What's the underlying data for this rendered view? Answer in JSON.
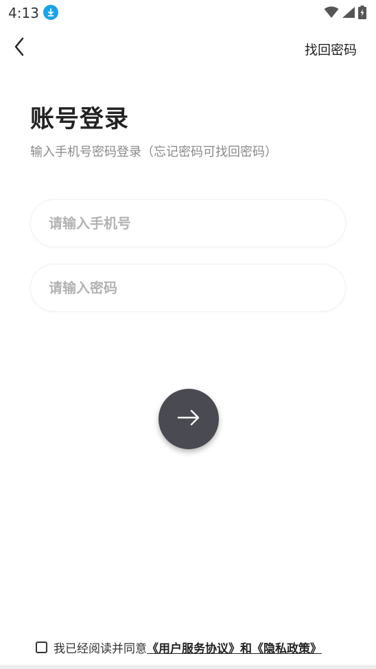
{
  "status_bar": {
    "time": "4:13",
    "download_icon": "download-icon",
    "wifi_icon": "wifi-icon",
    "signal_icon": "signal-icon",
    "battery_icon": "battery-charging-icon",
    "accent_color": "#1aa3e8"
  },
  "nav": {
    "back_icon": "chevron-left-icon",
    "forgot_password": "找回密码"
  },
  "header": {
    "title": "账号登录",
    "subtitle": "输入手机号密码登录（忘记密码可找回密码）"
  },
  "form": {
    "phone_placeholder": "请输入手机号",
    "phone_value": "",
    "password_placeholder": "请输入密码",
    "password_value": "",
    "submit_icon": "arrow-right-icon",
    "submit_color": "#4a4a52"
  },
  "agreement": {
    "prefix": "我已经阅读并同意",
    "user_agreement": "《用户服务协议》",
    "conjunction": "和",
    "privacy_policy": "《隐私政策》",
    "checked": false
  }
}
